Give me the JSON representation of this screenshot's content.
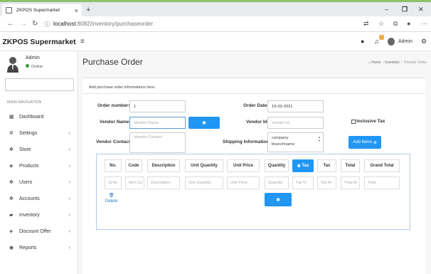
{
  "browser": {
    "tab_title": "ZKPOS Supermarket",
    "tab_close": "×",
    "new_tab": "+",
    "url_host": "localhost",
    "url_path": ":8082/inventory/purchaseorder",
    "win_minimize": "–",
    "win_maximize": "❐",
    "win_close": "✕"
  },
  "header": {
    "brand": "ZKPOS Supermarket",
    "admin_name": "Admin"
  },
  "sidebar": {
    "user_name": "Admin",
    "user_status": "Online",
    "nav_header": "MAIN NAVIGATION",
    "items": [
      {
        "label": "Dashboard",
        "icon": "dashboard-icon",
        "chevron": false
      },
      {
        "label": "Settings",
        "icon": "gear-icon",
        "chevron": true
      },
      {
        "label": "Store",
        "icon": "store-icon",
        "chevron": true
      },
      {
        "label": "Products",
        "icon": "products-icon",
        "chevron": true
      },
      {
        "label": "Users",
        "icon": "users-icon",
        "chevron": true
      },
      {
        "label": "Accounts",
        "icon": "accounts-icon",
        "chevron": true
      },
      {
        "label": "Inventory",
        "icon": "inventory-icon",
        "chevron": true
      },
      {
        "label": "Discount Offer",
        "icon": "plus-icon",
        "chevron": true
      },
      {
        "label": "Reports",
        "icon": "reports-icon",
        "chevron": true
      }
    ]
  },
  "page": {
    "title": "Purchase Order",
    "breadcrumb_home": "Home",
    "breadcrumb_section": "Inventory",
    "breadcrumb_current": "Transfer Order",
    "description": "Add purchase order informations here."
  },
  "form": {
    "order_numbers_label": "Order numbers",
    "order_numbers_value": "1",
    "order_date_label": "Order Date",
    "order_date_value": "10-02-2021",
    "vendor_name_label": "Vendor Name",
    "vendor_name_placeholder": "Vendor Name",
    "vendor_id_label": "Vendor Id",
    "vendor_id_placeholder": "Vendor Id",
    "inclusive_tax_label": "Inclusive Tax",
    "vendor_contact_label": "Vendor Contact",
    "vendor_contact_placeholder": "Vendor Contact",
    "shipping_label": "Shipping Information",
    "shipping_line1": "company",
    "shipping_line2": "branchname",
    "add_items_label": "Add Items"
  },
  "table": {
    "headers": [
      "No.",
      "Code",
      "Description",
      "Unit Quantity",
      "Unit Price",
      "Quantity",
      "Tax",
      "Tax",
      "Total",
      "Grand Total"
    ],
    "placeholders": [
      "Sl.No",
      "Item Co",
      "Description",
      "Unit Quantity",
      "Unit Price",
      "Quantity",
      "Tax %",
      "Tax Ar",
      "Total Ar",
      "Total"
    ],
    "delete_label": "Delete"
  },
  "colors": {
    "accent": "#2196f3",
    "online": "#3c9a3c",
    "frame": "#8dc16b"
  }
}
